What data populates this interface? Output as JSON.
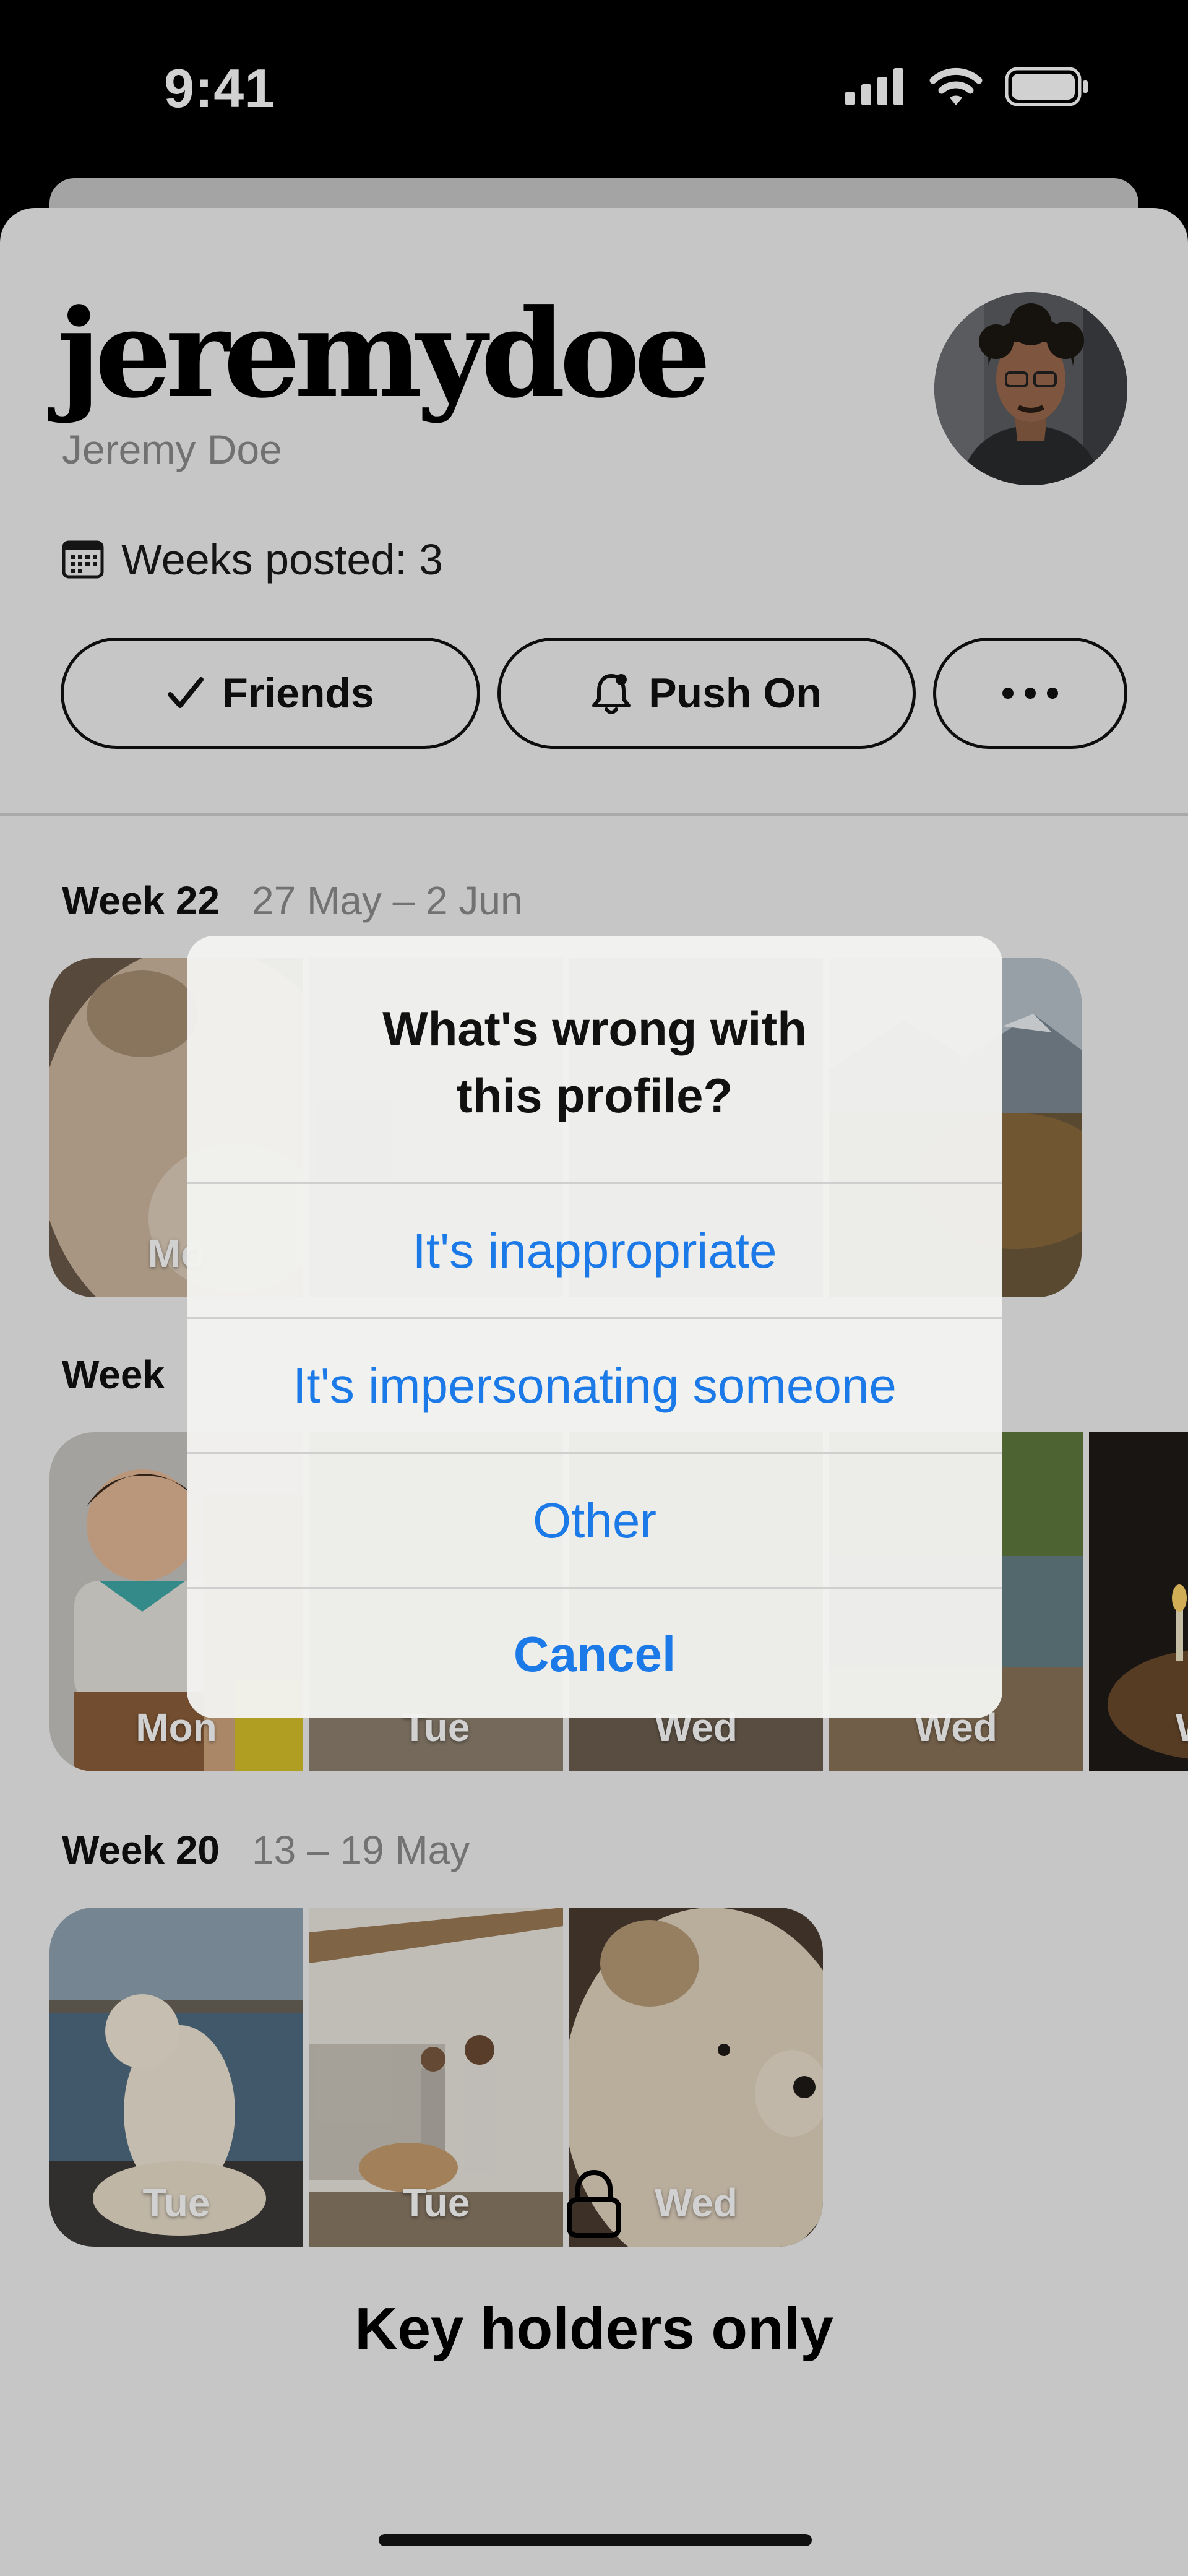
{
  "status_bar": {
    "time": "9:41"
  },
  "profile": {
    "username": "jeremydoe",
    "full_name": "Jeremy Doe",
    "weeks_posted": "Weeks posted: 3"
  },
  "actions": {
    "friends": "Friends",
    "push": "Push On",
    "more": "•••"
  },
  "weeks": [
    {
      "label": "Week 22",
      "range": "27 May – 2 Jun",
      "days": [
        "Mo",
        "",
        "",
        ""
      ]
    },
    {
      "label": "Week",
      "range": "",
      "days": [
        "Mon",
        "Tue",
        "Wed",
        "Wed",
        "W"
      ]
    },
    {
      "label": "Week 20",
      "range": "13 – 19 May",
      "days": [
        "Tue",
        "Tue",
        "Wed"
      ]
    }
  ],
  "locked": {
    "text": "Key holders only"
  },
  "alert": {
    "title_line1": "What's wrong with",
    "title_line2": "this profile?",
    "options": [
      "It's inappropriate",
      "It's impersonating someone",
      "Other"
    ],
    "cancel": "Cancel"
  },
  "colors": {
    "accent": "#1b7ae8",
    "sheet": "#f2f2f2"
  }
}
